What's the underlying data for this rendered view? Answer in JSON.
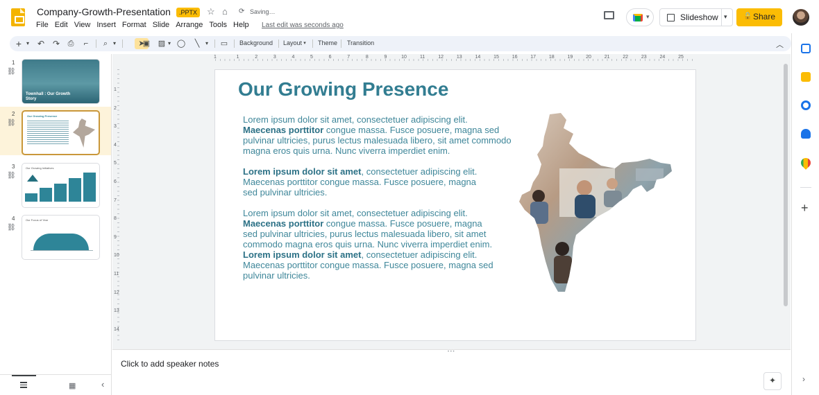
{
  "doc": {
    "title": "Company-Growth-Presentation",
    "badge": ".PPTX",
    "status": "Saving…",
    "last_edit": "Last edit was seconds ago"
  },
  "menu": [
    "File",
    "Edit",
    "View",
    "Insert",
    "Format",
    "Slide",
    "Arrange",
    "Tools",
    "Help"
  ],
  "header_buttons": {
    "slideshow": "Slideshow",
    "share": "Share"
  },
  "toolbar": {
    "background": "Background",
    "layout": "Layout",
    "theme": "Theme",
    "transition": "Transition"
  },
  "ruler": {
    "top_ticks": [
      "1",
      "1",
      "2",
      "3",
      "4",
      "5",
      "6",
      "7",
      "8",
      "9",
      "10",
      "11",
      "12",
      "13",
      "14",
      "15",
      "16",
      "17",
      "18",
      "19",
      "20",
      "21",
      "22",
      "23",
      "24",
      "25"
    ],
    "left_ticks": [
      "1",
      "2",
      "3",
      "4",
      "5",
      "6",
      "7",
      "8",
      "9",
      "10",
      "11",
      "12",
      "13",
      "14"
    ]
  },
  "filmstrip": {
    "slides": [
      {
        "number": "1",
        "title": "Townhall : Our Growth Story"
      },
      {
        "number": "2",
        "title": "Our Growing Presence"
      },
      {
        "number": "3",
        "title": "Our Growing Initiatives"
      },
      {
        "number": "4",
        "title": "Our Focus of Year"
      }
    ]
  },
  "slide": {
    "title": "Our Growing Presence",
    "paragraphs": [
      {
        "lines": [
          [
            {
              "t": "Lorem ipsum dolor sit amet, consectetuer adipiscing elit.",
              "b": false
            }
          ],
          [
            {
              "t": "Maecenas porttitor",
              "b": true
            },
            {
              "t": " congue massa. Fusce posuere, magna sed",
              "b": false
            }
          ],
          [
            {
              "t": "pulvinar ultricies, purus lectus malesuada libero, sit amet commodo",
              "b": false
            }
          ],
          [
            {
              "t": "magna eros quis urna. Nunc viverra imperdiet enim.",
              "b": false
            }
          ]
        ]
      },
      {
        "lines": [
          [
            {
              "t": "Lorem ipsum dolor sit amet",
              "b": true
            },
            {
              "t": ", consectetuer adipiscing elit.",
              "b": false
            }
          ],
          [
            {
              "t": "Maecenas porttitor congue massa. Fusce posuere, magna",
              "b": false
            }
          ],
          [
            {
              "t": "sed pulvinar ultricies.",
              "b": false
            }
          ]
        ]
      },
      {
        "lines": [
          [
            {
              "t": "Lorem ipsum dolor sit amet, consectetuer adipiscing elit.",
              "b": false
            }
          ],
          [
            {
              "t": "Maecenas porttitor",
              "b": true
            },
            {
              "t": " congue massa. Fusce posuere, magna",
              "b": false
            }
          ],
          [
            {
              "t": "sed pulvinar ultricies, purus lectus malesuada libero, sit amet",
              "b": false
            }
          ],
          [
            {
              "t": "commodo magna eros quis urna. Nunc viverra imperdiet enim.",
              "b": false
            }
          ],
          [
            {
              "t": "Lorem ipsum dolor sit amet",
              "b": true
            },
            {
              "t": ", consectetuer adipiscing elit.",
              "b": false
            }
          ],
          [
            {
              "t": "Maecenas porttitor congue massa. Fusce posuere, magna sed",
              "b": false
            }
          ],
          [
            {
              "t": "pulvinar ultricies.",
              "b": false
            }
          ]
        ]
      }
    ]
  },
  "notes": {
    "placeholder": "Click to add speaker notes"
  },
  "icons": {
    "undo": "undo-icon",
    "redo": "redo-icon",
    "print": "print-icon",
    "paint_format": "paint-format-icon",
    "zoom": "zoom-icon",
    "select": "cursor-icon",
    "textbox": "textbox-icon",
    "image": "image-icon",
    "shape": "shape-icon",
    "line": "line-icon",
    "comment": "add-comment-icon"
  },
  "colors": {
    "accent": "#fbbc04",
    "slide_title": "#327d91",
    "slide_text": "#3e8699"
  }
}
